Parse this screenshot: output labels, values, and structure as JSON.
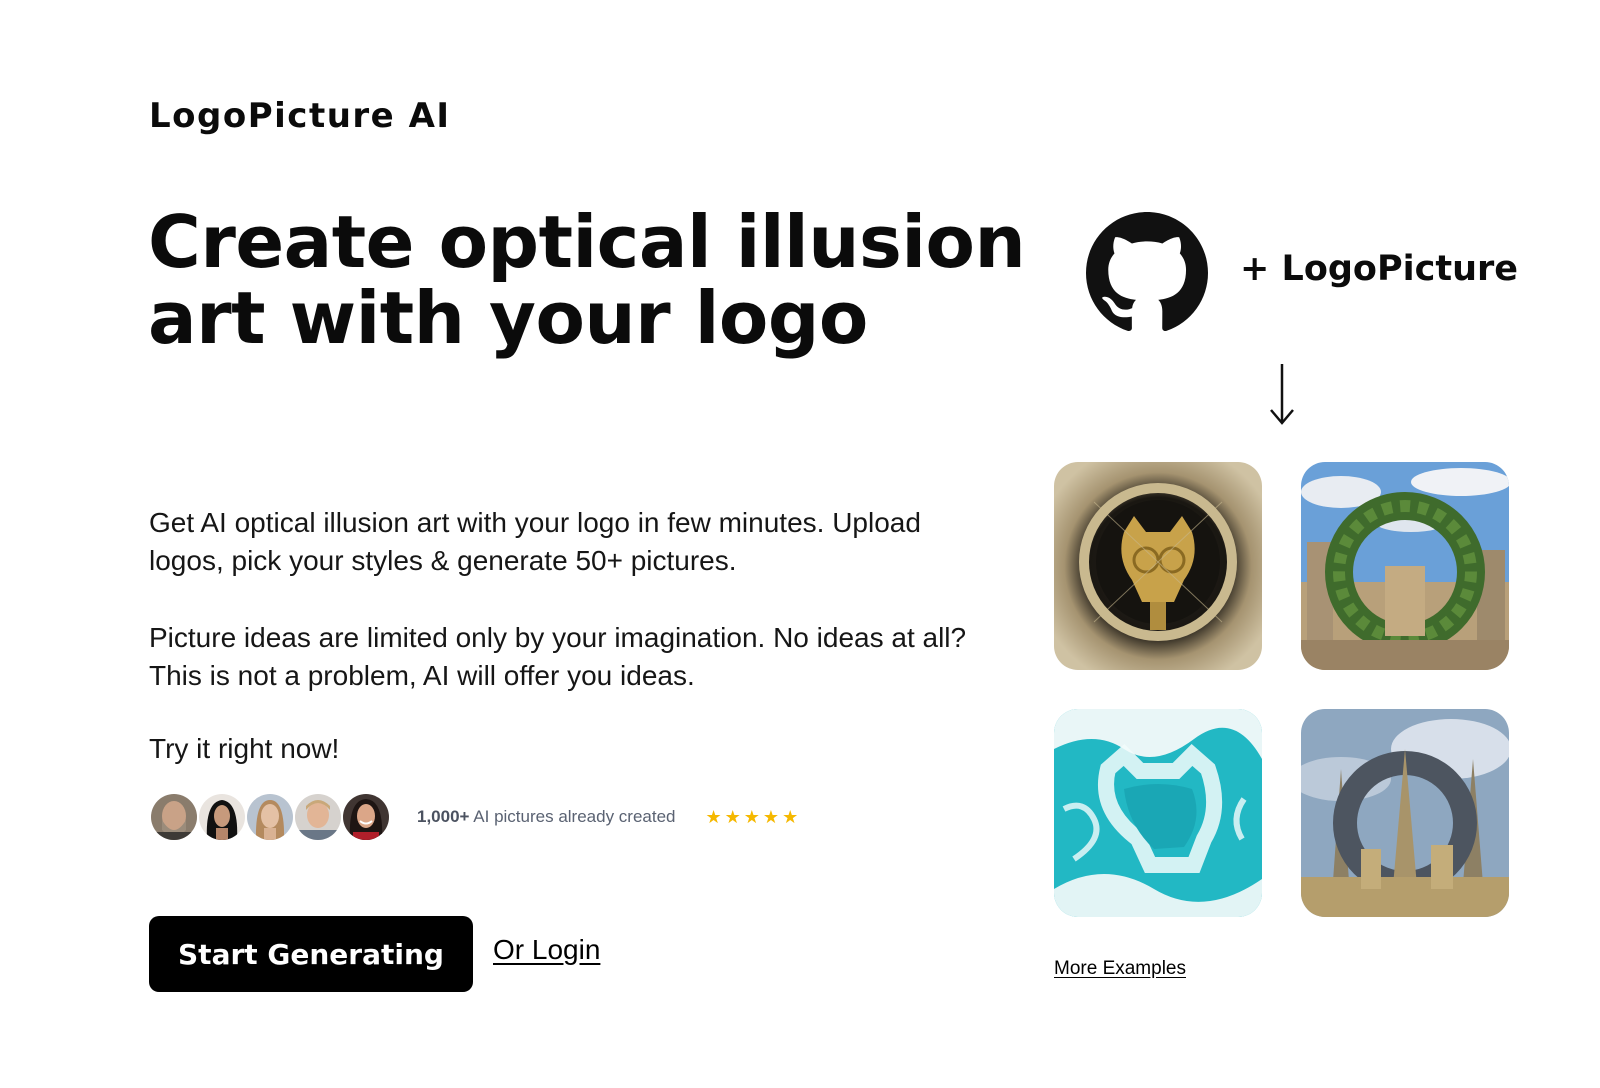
{
  "brand": {
    "name": "LogoPicture AI"
  },
  "hero": {
    "title": "Create optical illusion art with your logo"
  },
  "description": {
    "paragraph_1": "Get AI optical illusion art with your logo in few minutes. Upload logos, pick your styles & generate 50+ pictures.",
    "paragraph_2": "Picture ideas are limited only by your imagination. No ideas at all? This is not a problem, AI will offer you ideas.",
    "cta_text": "Try it right now!"
  },
  "social_proof": {
    "count": "1,000+",
    "text": "AI pictures already created",
    "rating_stars": 5,
    "avatars": [
      "avatar-bearded-man",
      "avatar-woman-dark-hair",
      "avatar-woman-blonde",
      "avatar-older-man",
      "avatar-woman-smiling"
    ]
  },
  "actions": {
    "primary_label": "Start Generating",
    "login_label": "Or Login"
  },
  "showcase": {
    "input_icon": "github-icon",
    "plus_label": "+ LogoPicture",
    "arrow_icon": "arrow-down-icon",
    "examples": [
      "steampunk-clock-octocat",
      "ancient-ruins-arch",
      "ocean-waves-octocat",
      "fantasy-castle-octocat"
    ],
    "more_label": "More Examples"
  },
  "colors": {
    "primary_button": "#000000",
    "star": "#f5b800",
    "muted_text": "#5a6272"
  }
}
